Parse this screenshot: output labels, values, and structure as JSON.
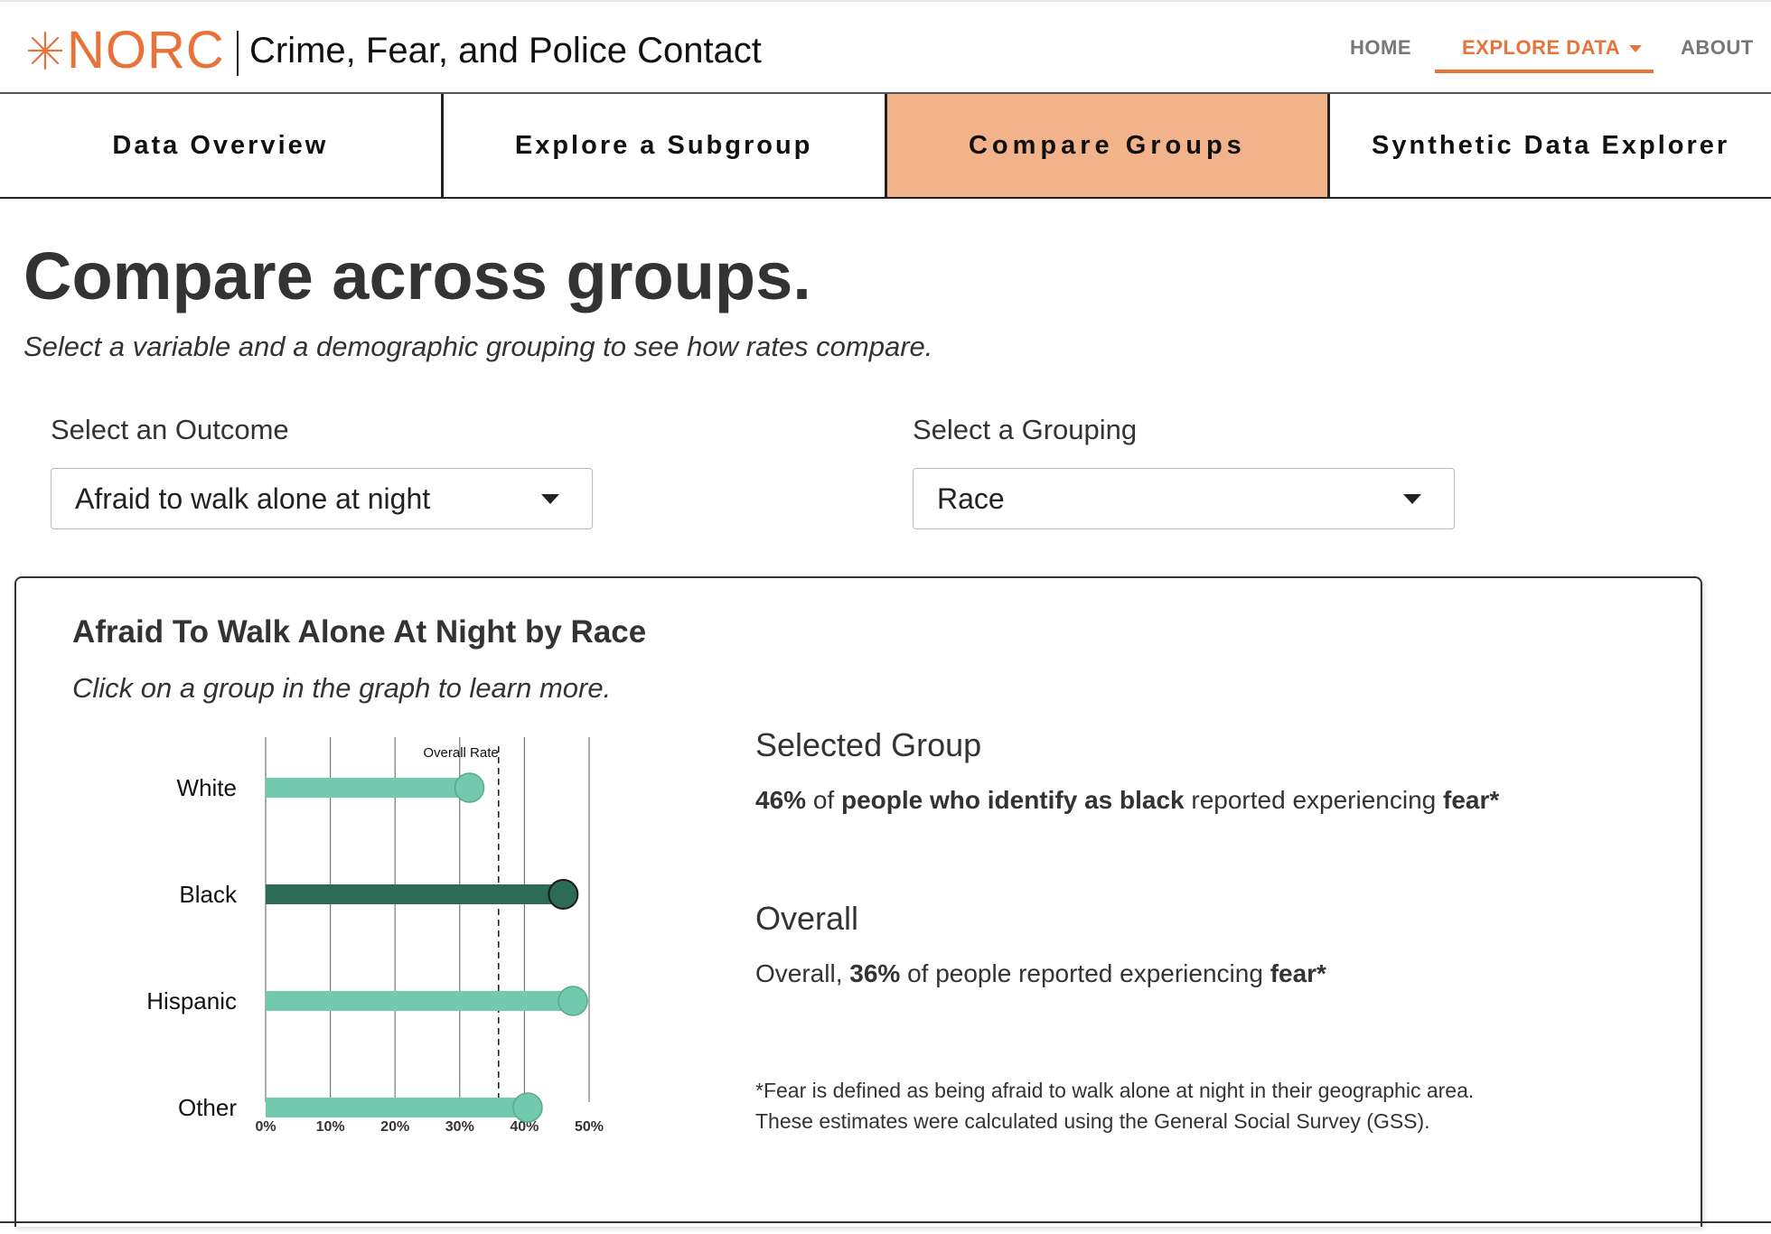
{
  "header": {
    "logo_text": "NORC",
    "site_title": "Crime, Fear, and Police Contact",
    "nav": {
      "home": "HOME",
      "explore": "EXPLORE DATA",
      "about": "ABOUT"
    },
    "accent_color": "#e8733a"
  },
  "tabs": [
    {
      "label": "Data Overview",
      "active": false
    },
    {
      "label": "Explore a Subgroup",
      "active": false
    },
    {
      "label": "Compare Groups",
      "active": true
    },
    {
      "label": "Synthetic Data Explorer",
      "active": false
    }
  ],
  "page": {
    "title": "Compare across groups.",
    "subtitle": "Select a variable and a demographic grouping to see how rates compare."
  },
  "selects": {
    "outcome_label": "Select an Outcome",
    "outcome_value": "Afraid to walk alone at night",
    "grouping_label": "Select a Grouping",
    "grouping_value": "Race"
  },
  "card": {
    "title": "Afraid To Walk Alone At Night by Race",
    "subtitle": "Click on a group in the graph to learn more."
  },
  "info": {
    "selected_heading": "Selected Group",
    "selected_pct": "46%",
    "selected_of": " of ",
    "selected_group": "people who identify as black",
    "selected_mid": " reported experiencing ",
    "selected_outcome": "fear*",
    "overall_heading": "Overall",
    "overall_prefix": "Overall, ",
    "overall_pct": "36%",
    "overall_mid": " of people reported experiencing ",
    "overall_outcome": "fear*",
    "footnote_1": "*Fear is defined as being afraid to walk alone at night in their geographic area.",
    "footnote_2": "These estimates were calculated using the General Social Survey (GSS)."
  },
  "chart_data": {
    "type": "bar",
    "orientation": "horizontal",
    "categories": [
      "White",
      "Black",
      "Hispanic",
      "Other"
    ],
    "values": [
      31.5,
      46,
      47.5,
      40.5
    ],
    "selected": "Black",
    "reference_line": {
      "label": "Overall Rate",
      "value": 36
    },
    "x_ticks": [
      "0%",
      "10%",
      "20%",
      "30%",
      "40%",
      "50%"
    ],
    "xlim": [
      0,
      50
    ],
    "grid": true,
    "colors": {
      "default": "#72c9ae",
      "selected": "#2c6b55",
      "dot_stroke": "#222"
    }
  }
}
